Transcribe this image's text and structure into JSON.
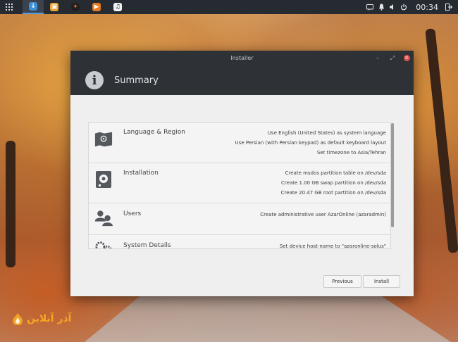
{
  "panel": {
    "apps": [
      {
        "name": "download-icon",
        "color": "#3d8fd6",
        "glyph": "↓",
        "active": true
      },
      {
        "name": "files-icon",
        "color": "#e8a33a",
        "glyph": "▣",
        "active": false
      },
      {
        "name": "browser-icon",
        "color": "#e06a2a",
        "glyph": "✦",
        "active": false
      },
      {
        "name": "media-player-icon",
        "color": "#e9791f",
        "glyph": "▶",
        "active": false
      },
      {
        "name": "music-icon",
        "color": "#2b2e33",
        "glyph": "♫",
        "active": false
      }
    ],
    "clock": "00:34"
  },
  "window": {
    "title": "Installer",
    "header_title": "Summary",
    "rows": [
      {
        "label": "Language & Region",
        "details": [
          "Use English (United States) as system language",
          "Use Persian (with Persian keypad) as default keyboard layout",
          "Set timezone to Asia/Tehran"
        ]
      },
      {
        "label": "Installation",
        "details": [
          "Create msdos partition table on /dev/sda",
          "Create 1.00 GB swap partition on /dev/sda",
          "Create 20.47 GB root partition on /dev/sda"
        ]
      },
      {
        "label": "Users",
        "details": [
          "Create administrative user AzarOnline (azaradmin)"
        ]
      },
      {
        "label": "System Details",
        "details": [
          "Set device host-name to \"azaronline-solus\""
        ]
      }
    ],
    "previous_label": "Previous",
    "install_label": "Install"
  },
  "watermark": {
    "text": "آذر آنلاین"
  },
  "colors": {
    "panel_bg": "#262a31",
    "header_bg": "#2e3136",
    "accent": "#4e9de6",
    "close": "#d9534f"
  }
}
